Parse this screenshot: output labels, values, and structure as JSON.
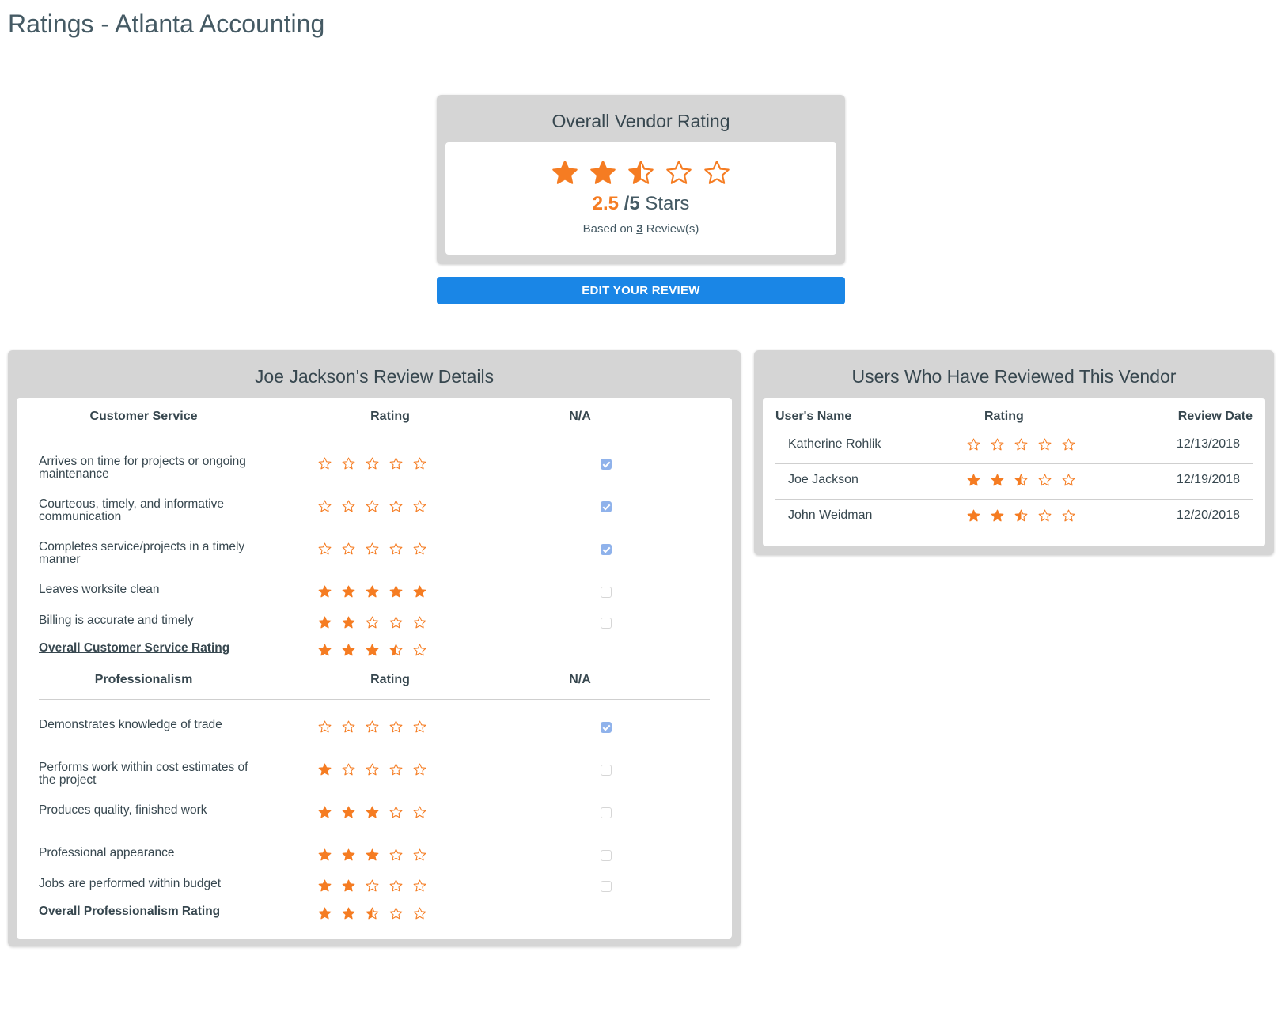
{
  "page": {
    "title": "Ratings - Atlanta Accounting"
  },
  "colors": {
    "star": "#f57c22",
    "button": "#1a86e6",
    "panel": "#d5d5d5",
    "checkbox_checked": "#8fb2eb"
  },
  "overall": {
    "title": "Overall Vendor Rating",
    "rating": 2.5,
    "rating_label": "2.5",
    "max_label": "/5",
    "stars_word": " Stars",
    "based_prefix": "Based on ",
    "review_count": "3",
    "based_suffix": " Review(s)"
  },
  "edit_button": {
    "label": "EDIT YOUR REVIEW"
  },
  "details": {
    "title": "Joe Jackson's Review Details",
    "sections": [
      {
        "header": "Customer Service",
        "rating_header": "Rating",
        "na_header": "N/A",
        "rows": [
          {
            "label": "Arrives on time for projects or ongoing maintenance",
            "rating": 0,
            "na": true
          },
          {
            "label": "Courteous, timely, and informative communication",
            "rating": 0,
            "na": true
          },
          {
            "label": "Completes service/projects in a timely manner",
            "rating": 0,
            "na": true
          },
          {
            "label": "Leaves worksite clean",
            "rating": 5,
            "na": false
          },
          {
            "label": "Billing is accurate and timely",
            "rating": 2,
            "na": false
          }
        ],
        "overall": {
          "label": "Overall Customer Service Rating",
          "rating": 3.5
        }
      },
      {
        "header": "Professionalism",
        "rating_header": "Rating",
        "na_header": "N/A",
        "rows": [
          {
            "label": "Demonstrates knowledge of trade",
            "rating": 0,
            "na": true
          },
          {
            "label": "Performs work within cost estimates of the project",
            "rating": 1,
            "na": false
          },
          {
            "label": "Produces quality, finished work",
            "rating": 3,
            "na": false
          },
          {
            "label": "Professional appearance",
            "rating": 3,
            "na": false
          },
          {
            "label": "Jobs are performed within budget",
            "rating": 2,
            "na": false
          }
        ],
        "overall": {
          "label": "Overall Professionalism Rating",
          "rating": 2.5
        }
      }
    ]
  },
  "reviewers": {
    "title": "Users Who Have Reviewed This Vendor",
    "headers": {
      "name": "User's Name",
      "rating": "Rating",
      "date": "Review Date"
    },
    "rows": [
      {
        "name": "Katherine Rohlik",
        "rating": 0,
        "date": "12/13/2018"
      },
      {
        "name": "Joe Jackson",
        "rating": 2.5,
        "date": "12/19/2018"
      },
      {
        "name": "John Weidman",
        "rating": 2.5,
        "date": "12/20/2018"
      }
    ]
  },
  "icons": {
    "star_full": "star-full-icon",
    "star_half": "star-half-icon",
    "star_empty": "star-empty-icon",
    "checkbox": "checkbox-icon"
  }
}
